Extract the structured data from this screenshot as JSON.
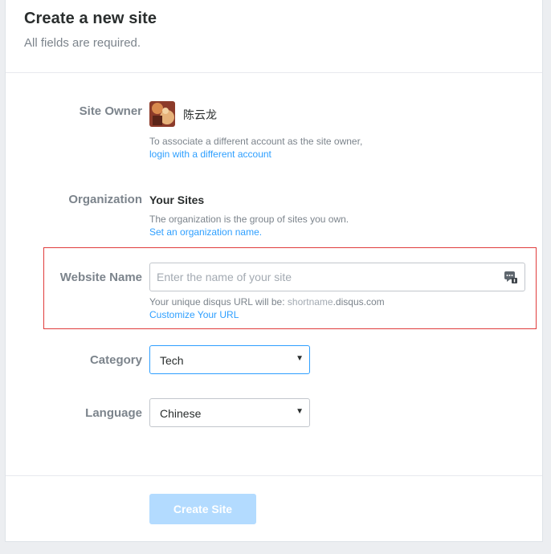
{
  "header": {
    "title": "Create a new site",
    "subtitle": "All fields are required."
  },
  "site_owner": {
    "label": "Site Owner",
    "username": "陈云龙",
    "help_text": "To associate a different account as the site owner,",
    "link_text": "login with a different account"
  },
  "organization": {
    "label": "Organization",
    "value": "Your Sites",
    "help_text": "The organization is the group of sites you own.",
    "link_text": "Set an organization name."
  },
  "website_name": {
    "label": "Website Name",
    "placeholder": "Enter the name of your site",
    "help_prefix": "Your unique disqus URL will be: ",
    "help_shortname": "shortname",
    "help_domain": ".disqus.com",
    "link_text": "Customize Your URL"
  },
  "category": {
    "label": "Category",
    "selected": "Tech",
    "caret": "▼"
  },
  "language": {
    "label": "Language",
    "selected": "Chinese",
    "caret": "▼"
  },
  "footer": {
    "create_button": "Create Site"
  },
  "colors": {
    "link": "#2e9fff",
    "highlight_border": "#e03c3c",
    "button_disabled": "#b3dbff",
    "focused_select_border": "#2e9fff"
  }
}
